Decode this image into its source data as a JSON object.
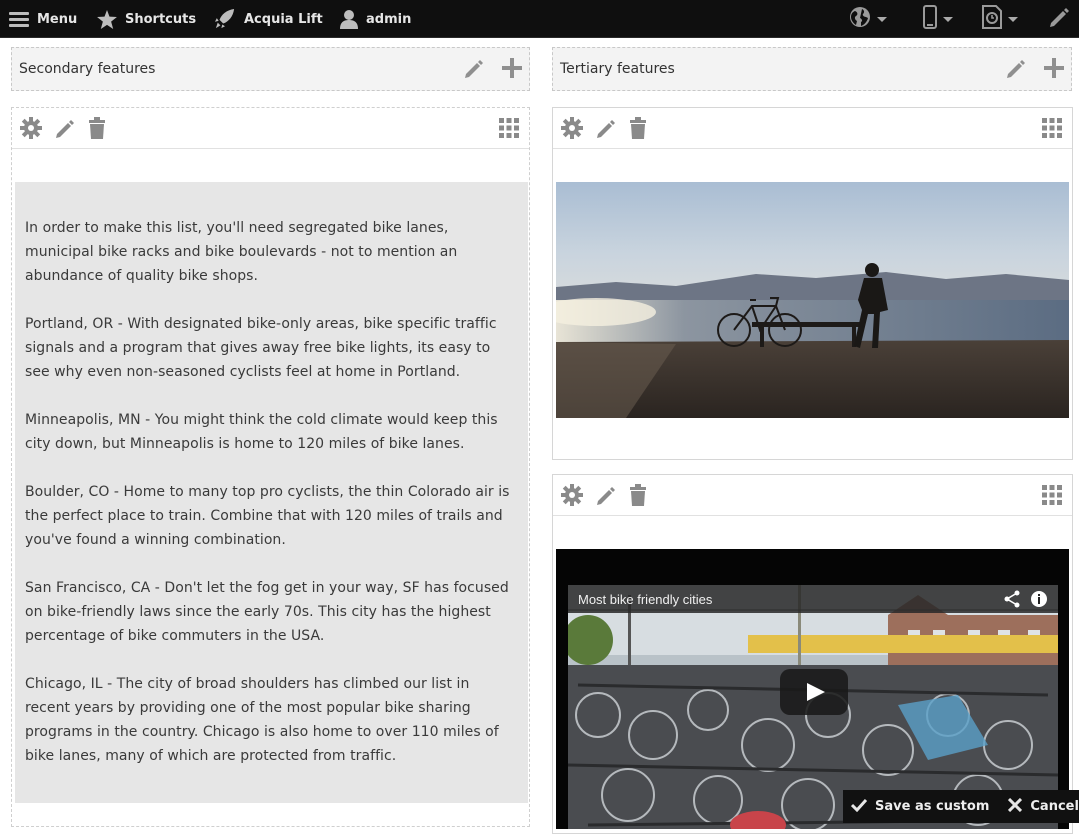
{
  "toolbar": {
    "menu_label": "Menu",
    "shortcuts_label": "Shortcuts",
    "lift_label": "Acquia Lift",
    "user_label": "admin",
    "icons": [
      "hamburger-icon",
      "star-icon",
      "rocket-icon",
      "user-icon",
      "globe-icon",
      "phone-icon",
      "clock-document-icon",
      "pencil-icon"
    ]
  },
  "regions": {
    "secondary": {
      "title": "Secondary features"
    },
    "tertiary": {
      "title": "Tertiary features"
    }
  },
  "text_pane": {
    "paragraphs": [
      "In order to make this list, you'll need segregated bike lanes, municipal bike racks and bike boulevards - not to mention an abundance of quality bike shops.",
      "Portland, OR - With designated bike-only areas, bike specific traffic signals and a program that gives away free bike lights, its easy to see why even non-seasoned cyclists feel at home in Portland.",
      "Minneapolis, MN - You might think the cold climate would keep this city down, but Minneapolis is home to 120 miles of bike lanes.",
      "Boulder, CO - Home to many top pro cyclists, the thin Colorado air is the perfect place to train. Combine that with 120 miles of trails and you've found a winning combination.",
      "San Francisco, CA - Don't let the fog get in your way, SF has focused on bike-friendly laws since the early 70s. This city has the highest percentage of bike commuters in the USA.",
      "Chicago, IL - The city of broad shoulders has climbed our list in recent years by providing one of the most popular bike sharing programs in the country. Chicago is also home to over 110 miles of bike lanes, many of which are protected from traffic."
    ]
  },
  "video": {
    "title": "Most bike friendly cities"
  },
  "actions": {
    "save_label": "Save as custom",
    "cancel_label": "Cancel"
  },
  "colors": {
    "toolbar_bg": "#0f0f0f",
    "text_block_bg": "#e6e6e6",
    "icon_gray": "#8a8a8a"
  }
}
